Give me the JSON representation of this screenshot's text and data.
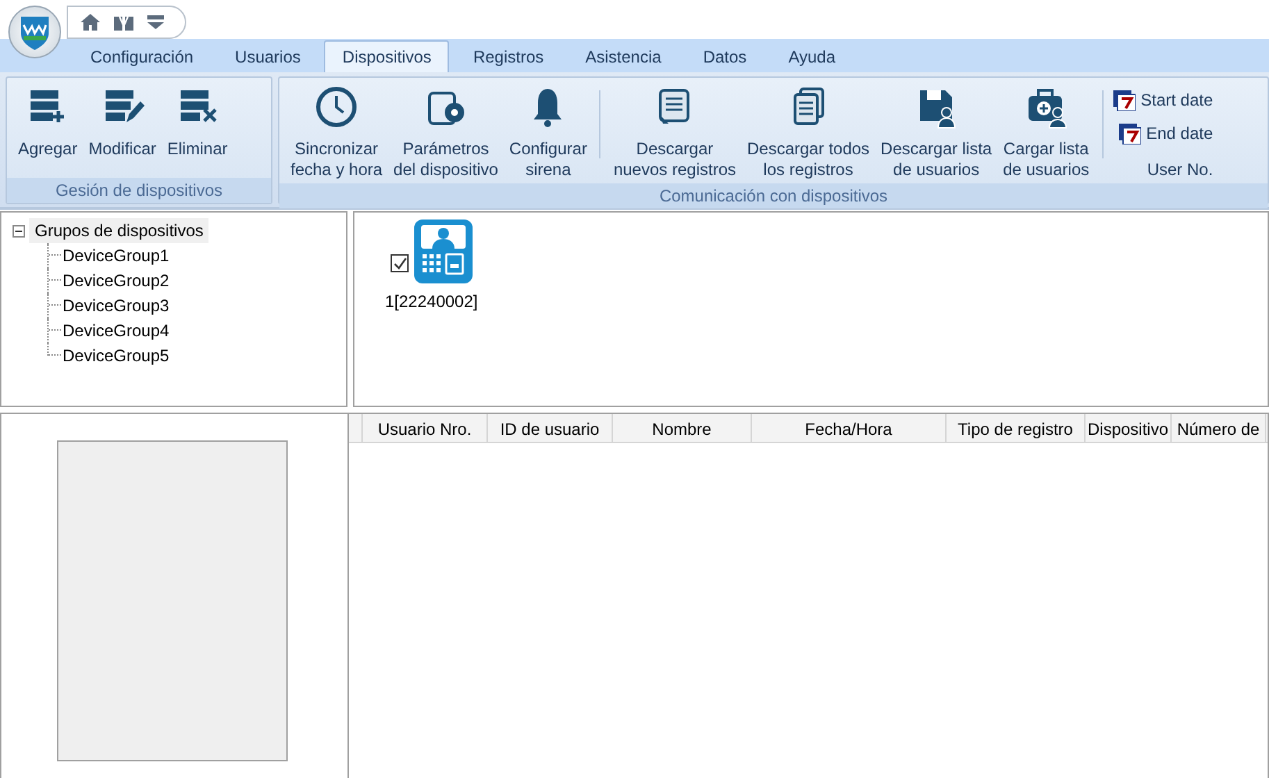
{
  "tabs": [
    {
      "label": "Configuración",
      "selected": false
    },
    {
      "label": "Usuarios",
      "selected": false
    },
    {
      "label": "Dispositivos",
      "selected": true
    },
    {
      "label": "Registros",
      "selected": false
    },
    {
      "label": "Asistencia",
      "selected": false
    },
    {
      "label": "Datos",
      "selected": false
    },
    {
      "label": "Ayuda",
      "selected": false
    }
  ],
  "ribbon_groups": [
    {
      "label": "Gesión de dispositivos",
      "sections": [
        {
          "buttons": [
            "Agregar",
            "Modificar",
            "Eliminar"
          ]
        }
      ]
    },
    {
      "label": "Comunicación con dispositivos",
      "sections": [
        {
          "buttons": [
            "Sincronizar\nfecha y hora",
            "Parámetros\ndel dispositivo",
            "Configurar\nsirena"
          ]
        },
        {
          "buttons": [
            "Descargar\nnuevos registros",
            "Descargar todos\nlos registros",
            "Descargar lista\nde usuarios",
            "Cargar lista\nde usuarios"
          ]
        },
        {
          "fields": [
            {
              "kind": "date",
              "label": "Start date"
            },
            {
              "kind": "date",
              "label": "End date"
            },
            {
              "kind": "text",
              "label": "User No."
            }
          ]
        }
      ]
    }
  ],
  "tree": {
    "label": "Grupos de dispositivos",
    "expanded": true,
    "selected": true,
    "children": [
      {
        "label": "DeviceGroup1"
      },
      {
        "label": "DeviceGroup2"
      },
      {
        "label": "DeviceGroup3"
      },
      {
        "label": "DeviceGroup4"
      },
      {
        "label": "DeviceGroup5"
      }
    ]
  },
  "devices": [
    {
      "label": "1[22240002]",
      "checked": true
    }
  ],
  "table": {
    "columns": [
      "Usuario Nro.",
      "ID de usuario",
      "Nombre",
      "Fecha/Hora",
      "Tipo de registro",
      "Dispositivo",
      "Número de"
    ]
  }
}
